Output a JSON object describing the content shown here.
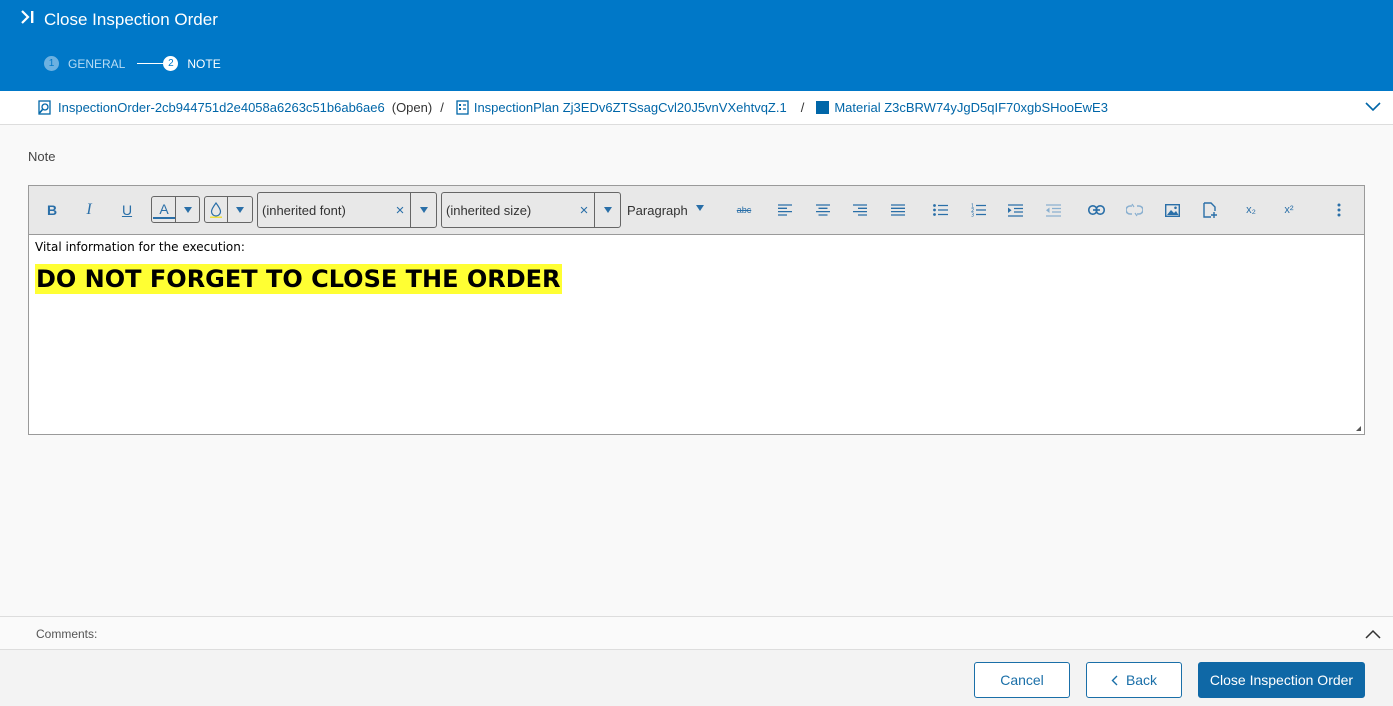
{
  "header": {
    "title": "Close Inspection Order",
    "steps": [
      {
        "number": "1",
        "label": "GENERAL",
        "active": false
      },
      {
        "number": "2",
        "label": "NOTE",
        "active": true
      }
    ]
  },
  "breadcrumb": {
    "order": "InspectionOrder-2cb944751d2e4058a6263c51b6ab6ae6",
    "order_status": "(Open)",
    "separator": "/",
    "plan": "InspectionPlan Zj3EDv6ZTSsagCvl20J5vnVXehtvqZ.1",
    "material": "Material Z3cBRW74yJgD5qIF70xgbSHooEwE3"
  },
  "note": {
    "label": "Note",
    "toolbar": {
      "bold": "B",
      "italic": "I",
      "underline": "U",
      "font_color": "A",
      "font_placeholder": "(inherited font)",
      "size_placeholder": "(inherited size)",
      "format": "Paragraph",
      "strikethrough": "abc",
      "subscript": "x₂",
      "superscript": "x²"
    },
    "content": {
      "line1": "Vital information for the execution:",
      "line2": "DO NOT FORGET TO CLOSE THE ORDER"
    }
  },
  "comments": {
    "label": "Comments:"
  },
  "footer": {
    "cancel": "Cancel",
    "back": "Back",
    "close": "Close Inspection Order"
  },
  "colors": {
    "header_bg": "#0078c8",
    "link": "#0066a8",
    "primary_button": "#0f68a6",
    "highlight": "#ffff33"
  }
}
